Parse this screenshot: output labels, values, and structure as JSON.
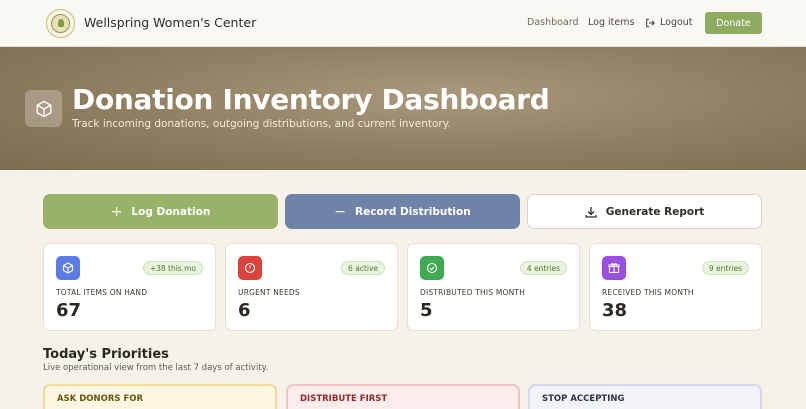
{
  "header": {
    "brand": "Wellspring Women's Center",
    "nav": {
      "dashboard": "Dashboard",
      "log_items": "Log items",
      "logout": "Logout"
    },
    "donate_label": "Donate"
  },
  "hero": {
    "title": "Donation Inventory Dashboard",
    "subtitle": "Track incoming donations, outgoing distributions, and current inventory."
  },
  "actions": {
    "log_donation": "Log Donation",
    "record_distribution": "Record Distribution",
    "generate_report": "Generate Report"
  },
  "stats": [
    {
      "label": "TOTAL ITEMS ON HAND",
      "value": "67",
      "badge": "+38 this mo",
      "icon": "cube-icon",
      "color": "#5b7be6"
    },
    {
      "label": "URGENT NEEDS",
      "value": "6",
      "badge": "6 active",
      "icon": "alert-icon",
      "color": "#d9433b"
    },
    {
      "label": "DISTRIBUTED THIS MONTH",
      "value": "5",
      "badge": "4 entries",
      "icon": "check-circle-icon",
      "color": "#3faa4f"
    },
    {
      "label": "RECEIVED THIS MONTH",
      "value": "38",
      "badge": "9 entries",
      "icon": "gift-icon",
      "color": "#9a4fe0"
    }
  ],
  "priorities": {
    "title": "Today's Priorities",
    "subtitle": "Live operational view from the last 7 days of activity.",
    "cards": [
      {
        "heading": "ASK DONORS FOR"
      },
      {
        "heading": "DISTRIBUTE FIRST"
      },
      {
        "heading": "STOP ACCEPTING"
      }
    ]
  },
  "colors": {
    "accent_green": "#98b368",
    "accent_blue": "#6f83a8",
    "hero_brown": "#8f7d5f"
  }
}
